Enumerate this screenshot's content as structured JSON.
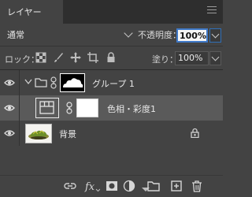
{
  "panel": {
    "tab_title": "レイヤー"
  },
  "blend": {
    "mode": "通常",
    "opacity_label": "不透明度：",
    "opacity_value": "100%"
  },
  "locks": {
    "label": "ロック：",
    "fill_label": "塗り：",
    "fill_value": "100%"
  },
  "layers": [
    {
      "name": "グループ 1",
      "type": "group",
      "expanded": true,
      "visible": true,
      "has_mask": true
    },
    {
      "name": "色相・彩度1",
      "type": "adjustment",
      "visible": true,
      "selected": true,
      "has_mask": true
    },
    {
      "name": "背景",
      "type": "image",
      "visible": true,
      "locked": true
    }
  ],
  "colors": {
    "panel_bg": "#434343",
    "selected_row": "#5a5a5a",
    "accent": "#3f79c8"
  },
  "bottom_icons": [
    "link-icon",
    "fx-icon",
    "mask-icon",
    "adjustment-icon",
    "folder-icon",
    "new-layer-icon",
    "trash-icon"
  ]
}
